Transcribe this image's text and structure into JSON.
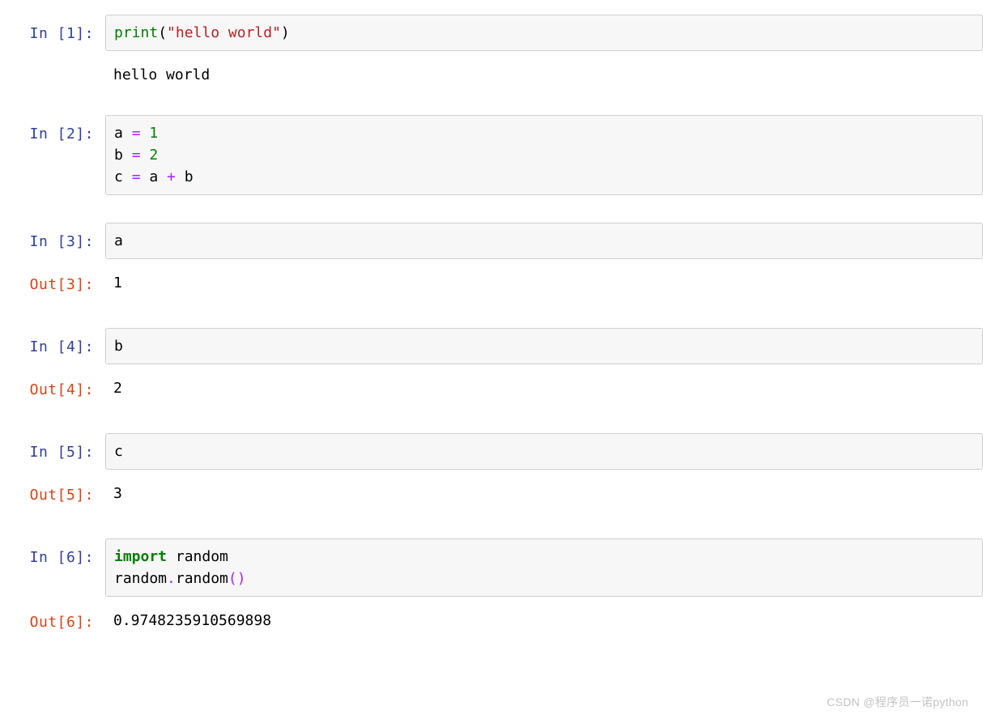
{
  "labels": {
    "in_prefix": "In ",
    "out_prefix": "Out"
  },
  "cells": [
    {
      "n": "1",
      "in_label": "In [1]:",
      "code": [
        {
          "tokens": [
            {
              "t": "print",
              "cls": "tok-builtin"
            },
            {
              "t": "(",
              "cls": "tok-paren-print"
            },
            {
              "t": "\"hello world\"",
              "cls": "tok-string"
            },
            {
              "t": ")",
              "cls": "tok-paren-print"
            }
          ]
        }
      ],
      "stream": "hello world"
    },
    {
      "n": "2",
      "in_label": "In [2]:",
      "code": [
        {
          "tokens": [
            {
              "t": "a ",
              "cls": "tok-var"
            },
            {
              "t": "=",
              "cls": "tok-op"
            },
            {
              "t": " ",
              "cls": "tok-var"
            },
            {
              "t": "1",
              "cls": "tok-num"
            }
          ]
        },
        {
          "tokens": [
            {
              "t": "b ",
              "cls": "tok-var"
            },
            {
              "t": "=",
              "cls": "tok-op"
            },
            {
              "t": " ",
              "cls": "tok-var"
            },
            {
              "t": "2",
              "cls": "tok-num"
            }
          ]
        },
        {
          "tokens": [
            {
              "t": "c ",
              "cls": "tok-var"
            },
            {
              "t": "=",
              "cls": "tok-op"
            },
            {
              "t": " a ",
              "cls": "tok-var"
            },
            {
              "t": "+",
              "cls": "tok-op"
            },
            {
              "t": " b",
              "cls": "tok-var"
            }
          ]
        }
      ]
    },
    {
      "n": "3",
      "in_label": "In [3]:",
      "code": [
        {
          "tokens": [
            {
              "t": "a",
              "cls": "tok-var"
            }
          ]
        }
      ],
      "out_label": "Out[3]:",
      "out": "1"
    },
    {
      "n": "4",
      "in_label": "In [4]:",
      "code": [
        {
          "tokens": [
            {
              "t": "b",
              "cls": "tok-var"
            }
          ]
        }
      ],
      "out_label": "Out[4]:",
      "out": "2"
    },
    {
      "n": "5",
      "in_label": "In [5]:",
      "code": [
        {
          "tokens": [
            {
              "t": "c",
              "cls": "tok-var"
            }
          ]
        }
      ],
      "out_label": "Out[5]:",
      "out": "3"
    },
    {
      "n": "6",
      "in_label": "In [6]:",
      "code": [
        {
          "tokens": [
            {
              "t": "import",
              "cls": "tok-keyword"
            },
            {
              "t": " random",
              "cls": "tok-var"
            }
          ]
        },
        {
          "tokens": [
            {
              "t": "random",
              "cls": "tok-var"
            },
            {
              "t": ".",
              "cls": "tok-op"
            },
            {
              "t": "random",
              "cls": "tok-var"
            },
            {
              "t": "(",
              "cls": "tok-paren2"
            },
            {
              "t": ")",
              "cls": "tok-paren2"
            }
          ]
        }
      ],
      "out_label": "Out[6]:",
      "out": "0.9748235910569898"
    }
  ],
  "watermark": "CSDN @程序员一诺python"
}
